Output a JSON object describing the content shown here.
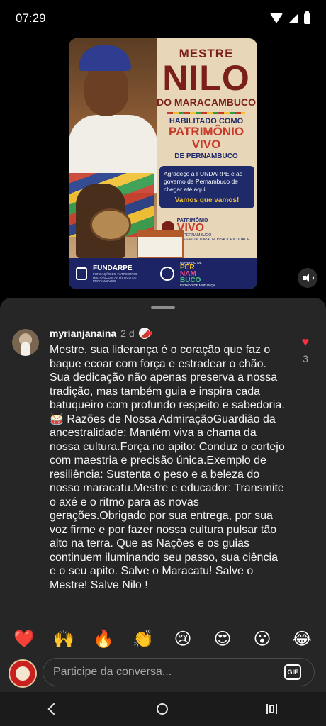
{
  "status_bar": {
    "time": "07:29"
  },
  "poster": {
    "title_top": "MESTRE",
    "title_main": "NILO",
    "title_sub": "DO MARACAMBUCO",
    "habilitado": "HABILITADO COMO",
    "patrimonio": "PATRIMÔNIO VIVO",
    "de_pernambuco": "DE PERNAMBUCO",
    "quote": "Agradeço à FUNDARPE e ao governo de Pernambuco de chegar até aqui.",
    "quote_strong": "Vamos que vamos!",
    "logo_line1": "PATRIMÔNIO",
    "logo_line2": "VIVO",
    "logo_line3": "DE PERNAMBUCO",
    "logo_line4": "NOSSA CULTURA, NOSSA IDENTIDADE.",
    "fundarpe": "FUNDARPE",
    "fundarpe_sub": "FUNDAÇÃO DO PATRIMÔNIO HISTÓRICO E ARTÍSTICO DE PERNAMBUCO",
    "gov_small": "GOVERNO DE",
    "gov_1": "PER",
    "gov_2": "NAM",
    "gov_3": "BUCO",
    "gov_tagline": "ESTADO DE MUDANÇA"
  },
  "comment": {
    "username": "myrianjanaina",
    "time": "2 d",
    "text": "Mestre, sua liderança é o coração que faz o baque ecoar com força e estradear o chão. Sua dedicação não apenas preserva a nossa tradição, mas também guia e inspira cada batuqueiro com profundo respeito e sabedoria.🥁 Razões de Nossa AdmiraçãoGuardião da ancestralidade: Mantém viva a chama da nossa cultura.Força no apito: Conduz o cortejo com maestria e precisão única.Exemplo de resiliência: Sustenta o peso e a beleza do nosso maracatu.Mestre e educador: Transmite o axé e o ritmo para as novas gerações.Obrigado por sua entrega, por sua voz firme e por fazer nossa cultura pulsar tão alto na terra. Que as Nações e os guias continuem iluminando seu passo, sua ciência e o seu apito. Salve o Maracatu! Salve o Mestre! Salve Nilo !",
    "like_count": "3"
  },
  "quick_reactions": [
    "❤️",
    "🙌",
    "🔥",
    "👏",
    "😢",
    "😍",
    "😮",
    "😂"
  ],
  "input": {
    "placeholder": "Participe da conversa...",
    "gif_label": "GIF"
  },
  "colors": {
    "like_red": "#ff3040",
    "sheet_bg": "#262626",
    "poster_navy": "#1c2466",
    "poster_red": "#7a1f1a"
  }
}
